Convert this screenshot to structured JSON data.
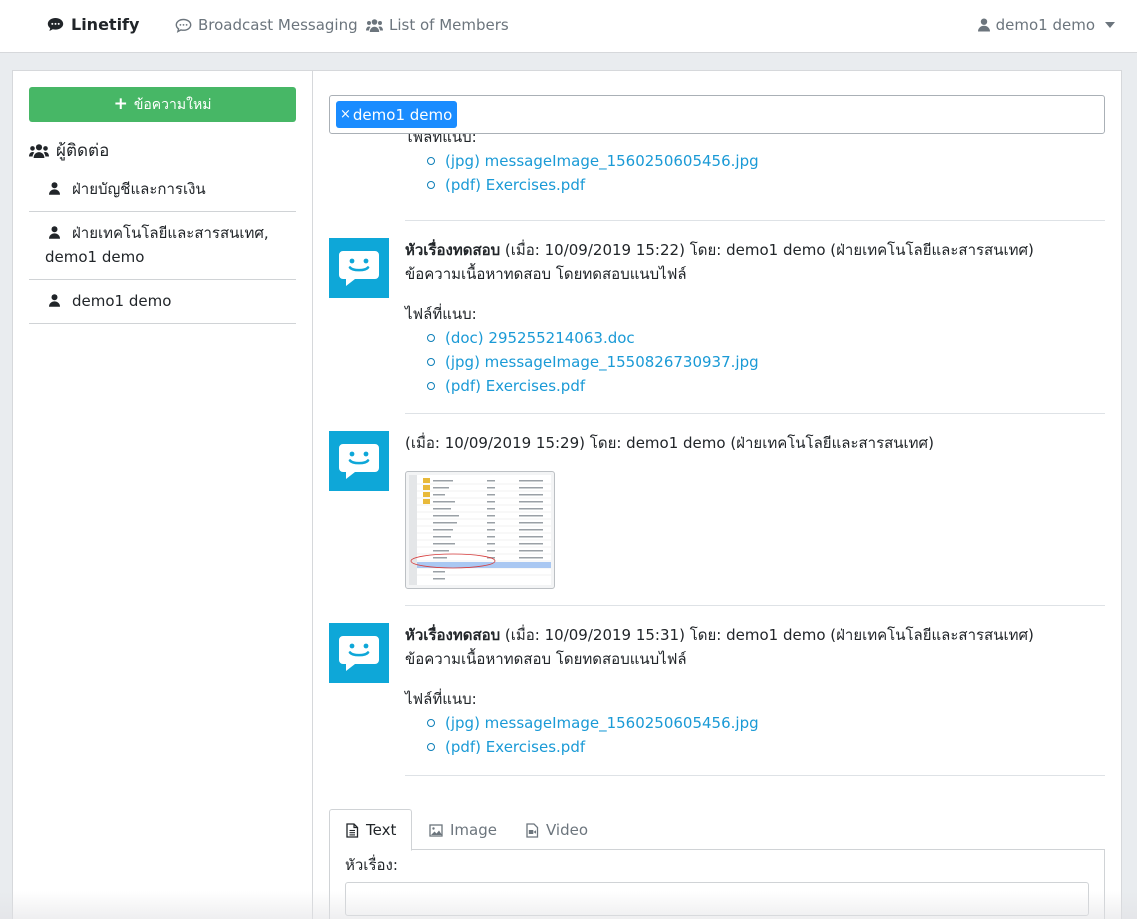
{
  "navbar": {
    "brand": "Linetify",
    "links": [
      "Broadcast Messaging",
      "List of Members"
    ],
    "user": "demo1 demo"
  },
  "sidebar": {
    "new_button": "ข้อความใหม่",
    "contacts_heading": "ผู้ติดต่อ",
    "contacts": [
      "ฝ่ายบัญชีและการเงิน",
      "ฝ่ายเทคโนโลยีและสารสนเทศ, demo1 demo",
      "demo1 demo"
    ]
  },
  "recipients": {
    "tags": [
      "demo1 demo"
    ],
    "remove_symbol": "×"
  },
  "messages": [
    {
      "files_label": "ไฟล์ที่แนบ:",
      "files": [
        "(jpg) messageImage_1560250605456.jpg",
        "(pdf) Exercises.pdf"
      ]
    },
    {
      "subject": "หัวเรื่องทดสอบ",
      "meta": " (เมื่อ: 10/09/2019 15:22) โดย: demo1 demo (ฝ่ายเทคโนโลยีและสารสนเทศ)",
      "body": "ข้อความเนื้อหาทดสอบ โดยทดสอบแนบไฟล์",
      "files_label": "ไฟล์ที่แนบ:",
      "files": [
        "(doc) 295255214063.doc",
        "(jpg) messageImage_1550826730937.jpg",
        "(pdf) Exercises.pdf"
      ]
    },
    {
      "meta": "(เมื่อ: 10/09/2019 15:29) โดย: demo1 demo (ฝ่ายเทคโนโลยีและสารสนเทศ)",
      "image_attachment": "file-list-screenshot"
    },
    {
      "subject": "หัวเรื่องทดสอบ",
      "meta": " (เมื่อ: 10/09/2019 15:31) โดย: demo1 demo (ฝ่ายเทคโนโลยีและสารสนเทศ)",
      "body": "ข้อความเนื้อหาทดสอบ โดยทดสอบแนบไฟล์",
      "files_label": "ไฟล์ที่แนบ:",
      "files": [
        "(jpg) messageImage_1560250605456.jpg",
        "(pdf) Exercises.pdf"
      ]
    }
  ],
  "composer": {
    "tabs": [
      "Text",
      "Image",
      "Video"
    ],
    "active_tab": "Text",
    "subject_label": "หัวเรื่อง:",
    "subject_value": ""
  },
  "colors": {
    "new_button": "#47b766",
    "tag": "#1a8cff",
    "avatar": "#0ea7d8",
    "link": "#1a9ad6"
  }
}
